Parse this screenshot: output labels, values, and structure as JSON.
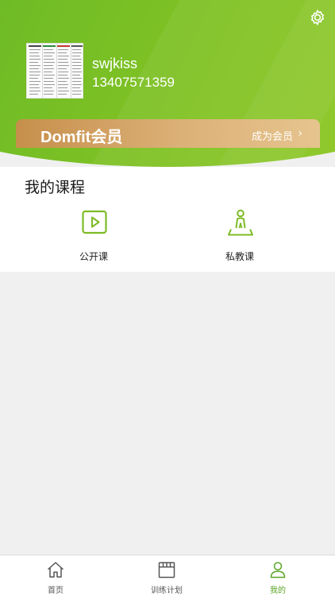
{
  "colors": {
    "brand_green": "#6ab825",
    "vip_gold": "#d4a664",
    "tab_active": "#5aa625"
  },
  "profile": {
    "username": "swjkiss",
    "phone": "13407571359",
    "settings_icon": "gear-icon"
  },
  "membership": {
    "title": "Domfit会员",
    "cta": "成为会员",
    "cta_icon": "chevron-right-icon"
  },
  "courses": {
    "title": "我的课程",
    "items": [
      {
        "label": "公开课",
        "icon": "play-video-icon"
      },
      {
        "label": "私教课",
        "icon": "personal-trainer-icon"
      }
    ]
  },
  "tabbar": {
    "items": [
      {
        "label": "首页",
        "icon": "home-icon",
        "active": false
      },
      {
        "label": "训练计划",
        "icon": "calendar-icon",
        "active": false
      },
      {
        "label": "我的",
        "icon": "user-icon",
        "active": true
      }
    ]
  }
}
